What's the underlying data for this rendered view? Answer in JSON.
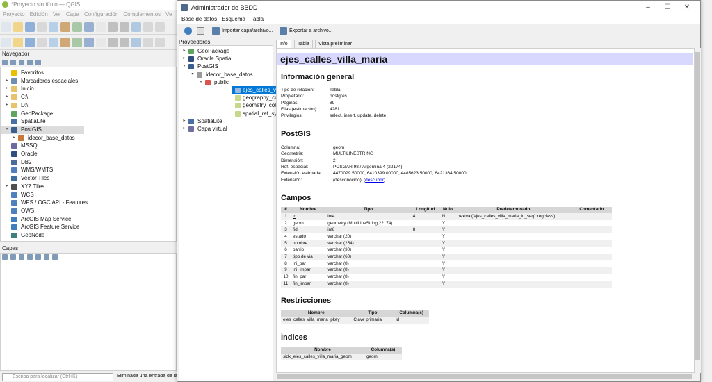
{
  "qgis": {
    "title": "*Proyecto sin título — QGIS",
    "menu": [
      "Proyecto",
      "Edición",
      "Ver",
      "Capa",
      "Configuración",
      "Complementos",
      "Ve"
    ],
    "navigator_title": "Navegador",
    "nav_items": [
      {
        "label": "Favoritos",
        "icon": "star-icon",
        "color": "#e8c000",
        "arrow": ""
      },
      {
        "label": "Marcadores espaciales",
        "icon": "bookmark-icon",
        "color": "#6f8fb0",
        "arrow": "▸"
      },
      {
        "label": "Inicio",
        "icon": "folder-icon",
        "color": "#e7c46b",
        "arrow": "▸"
      },
      {
        "label": "C:\\",
        "icon": "folder-icon",
        "color": "#e7c46b",
        "arrow": "▸"
      },
      {
        "label": "D:\\",
        "icon": "folder-icon",
        "color": "#e7c46b",
        "arrow": "▸"
      },
      {
        "label": "GeoPackage",
        "icon": "geopackage-icon",
        "color": "#5fa45f",
        "arrow": ""
      },
      {
        "label": "SpatiaLite",
        "icon": "spatialite-icon",
        "color": "#4a6fa5",
        "arrow": ""
      },
      {
        "label": "PostGIS",
        "icon": "postgis-icon",
        "color": "#3a5f8f",
        "arrow": "▾"
      },
      {
        "label": "idecor_base_datos",
        "icon": "connection-icon",
        "color": "#c97a3a",
        "arrow": "▸"
      },
      {
        "label": "MSSQL",
        "icon": "mssql-icon",
        "color": "#6b6b9f",
        "arrow": ""
      },
      {
        "label": "Oracle",
        "icon": "oracle-icon",
        "color": "#2f4f7f",
        "arrow": ""
      },
      {
        "label": "DB2",
        "icon": "db2-icon",
        "color": "#4b6b9b",
        "arrow": ""
      },
      {
        "label": "WMS/WMTS",
        "icon": "wms-icon",
        "color": "#4f7fbf",
        "arrow": ""
      },
      {
        "label": "Vector Tiles",
        "icon": "vector-tiles-icon",
        "color": "#3f6f9f",
        "arrow": ""
      },
      {
        "label": "XYZ Tiles",
        "icon": "xyz-tiles-icon",
        "color": "#4f4f4f",
        "arrow": "▸"
      },
      {
        "label": "WCS",
        "icon": "wcs-icon",
        "color": "#4f7fbf",
        "arrow": ""
      },
      {
        "label": "WFS / OGC API - Features",
        "icon": "wfs-icon",
        "color": "#4f7fbf",
        "arrow": ""
      },
      {
        "label": "OWS",
        "icon": "ows-icon",
        "color": "#4f7fbf",
        "arrow": ""
      },
      {
        "label": "ArcGIS Map Service",
        "icon": "arcgis-icon",
        "color": "#3f7fbf",
        "arrow": ""
      },
      {
        "label": "ArcGIS Feature Service",
        "icon": "arcgis-icon",
        "color": "#3f7fbf",
        "arrow": ""
      },
      {
        "label": "GeoNode",
        "icon": "geonode-icon",
        "color": "#3f7f7f",
        "arrow": ""
      }
    ],
    "layers_title": "Capas",
    "locator_placeholder": "Escriba para localizar (Ctrl+K)",
    "status_message": "Eliminada una entrada de la"
  },
  "dbm": {
    "title": "Administrador de BBDD",
    "menu": [
      "Base de datos",
      "Esquema",
      "Tabla"
    ],
    "toolbar": {
      "import": "Importar capa/archivo...",
      "export": "Exportar a archivo..."
    },
    "providers_label": "Proveedores",
    "tree": [
      {
        "label": "GeoPackage",
        "indent": 0,
        "arrow": "▸",
        "icon": "geopackage-icon",
        "color": "#5fa45f"
      },
      {
        "label": "Oracle Spatial",
        "indent": 0,
        "arrow": "▸",
        "icon": "oracle-icon",
        "color": "#2f4f7f"
      },
      {
        "label": "PostGIS",
        "indent": 0,
        "arrow": "▾",
        "icon": "postgis-icon",
        "color": "#3a5f8f"
      },
      {
        "label": "idecor_base_datos",
        "indent": 1,
        "arrow": "▾",
        "icon": "database-icon",
        "color": "#9a9a9a"
      },
      {
        "label": "public",
        "indent": 2,
        "arrow": "▾",
        "icon": "schema-icon",
        "color": "#d9534f"
      },
      {
        "label": "ejes_calles_villa_maria",
        "indent": 3,
        "arrow": "",
        "icon": "line-layer-icon",
        "color": "#9bb8e0",
        "sel": true
      },
      {
        "label": "geography_columns",
        "indent": 3,
        "arrow": "",
        "icon": "table-icon",
        "color": "#c8d88a"
      },
      {
        "label": "geometry_columns",
        "indent": 3,
        "arrow": "",
        "icon": "table-icon",
        "color": "#c8d88a"
      },
      {
        "label": "spatial_ref_sys",
        "indent": 3,
        "arrow": "",
        "icon": "table-icon",
        "color": "#c8d88a"
      },
      {
        "label": "SpatiaLite",
        "indent": 0,
        "arrow": "▸",
        "icon": "spatialite-icon",
        "color": "#4a6fa5"
      },
      {
        "label": "Capa virtual",
        "indent": 0,
        "arrow": "▸",
        "icon": "virtual-layer-icon",
        "color": "#6f6f9f"
      }
    ],
    "tabs": [
      "Info",
      "Tabla",
      "Vista preliminar"
    ],
    "info": {
      "table_name": "ejes_calles_villa_maria",
      "general_heading": "Información general",
      "general": [
        [
          "Tipo de relación:",
          "Tabla"
        ],
        [
          "Propietario:",
          "postgres"
        ],
        [
          "Páginas:",
          "89"
        ],
        [
          "Filas (estimación):",
          "4281"
        ],
        [
          "Privilegios:",
          "select, insert, update, delete"
        ]
      ],
      "postgis_heading": "PostGIS",
      "postgis": [
        [
          "Columna:",
          "geom"
        ],
        [
          "Geometría:",
          "MULTILINESTRING"
        ],
        [
          "Dimensión:",
          "2"
        ],
        [
          "Ref. espacial:",
          "POSGAR 98 / Argentina 4 (22174)"
        ],
        [
          "Extensión estimada:",
          "4470029.50000, 6410399.00000, 4485623.50000, 6421364.50000"
        ],
        [
          "Extensión:",
          "(desconocido)"
        ]
      ],
      "extent_link": "descubrir",
      "fields_heading": "Campos",
      "fields_headers": [
        "#",
        "Nombre",
        "Tipo",
        "Longitud",
        "Nulo",
        "Predeterminado",
        "Comentario"
      ],
      "fields": [
        [
          "1",
          "id",
          "int4",
          "4",
          "N",
          "nextval('ejes_calles_villa_maria_id_seq'::regclass)",
          ""
        ],
        [
          "2",
          "geom",
          "geometry (MultiLineString,22174)",
          "",
          "Y",
          "",
          ""
        ],
        [
          "3",
          "fid",
          "int8",
          "8",
          "Y",
          "",
          ""
        ],
        [
          "4",
          "estado",
          "varchar (20)",
          "",
          "Y",
          "",
          ""
        ],
        [
          "5",
          "nombre",
          "varchar (254)",
          "",
          "Y",
          "",
          ""
        ],
        [
          "6",
          "barrio",
          "varchar (30)",
          "",
          "Y",
          "",
          ""
        ],
        [
          "7",
          "tipo de via",
          "varchar (60)",
          "",
          "Y",
          "",
          ""
        ],
        [
          "8",
          "ini_par",
          "varchar (8)",
          "",
          "Y",
          "",
          ""
        ],
        [
          "9",
          "ini_impar",
          "varchar (8)",
          "",
          "Y",
          "",
          ""
        ],
        [
          "10",
          "fin_par",
          "varchar (8)",
          "",
          "Y",
          "",
          ""
        ],
        [
          "11",
          "fin_impar",
          "varchar (8)",
          "",
          "Y",
          "",
          ""
        ]
      ],
      "constraints_heading": "Restricciones",
      "constraints_headers": [
        "Nombre",
        "Tipo",
        "Columna(s)"
      ],
      "constraints": [
        [
          "ejes_calles_villa_maria_pkey",
          "Clave primaria",
          "id"
        ]
      ],
      "indexes_heading": "Índices",
      "indexes_headers": [
        "Nombre",
        "Columna(s)"
      ],
      "indexes": [
        [
          "sidx_ejes_calles_villa_maria_geom",
          "geom"
        ]
      ]
    }
  }
}
